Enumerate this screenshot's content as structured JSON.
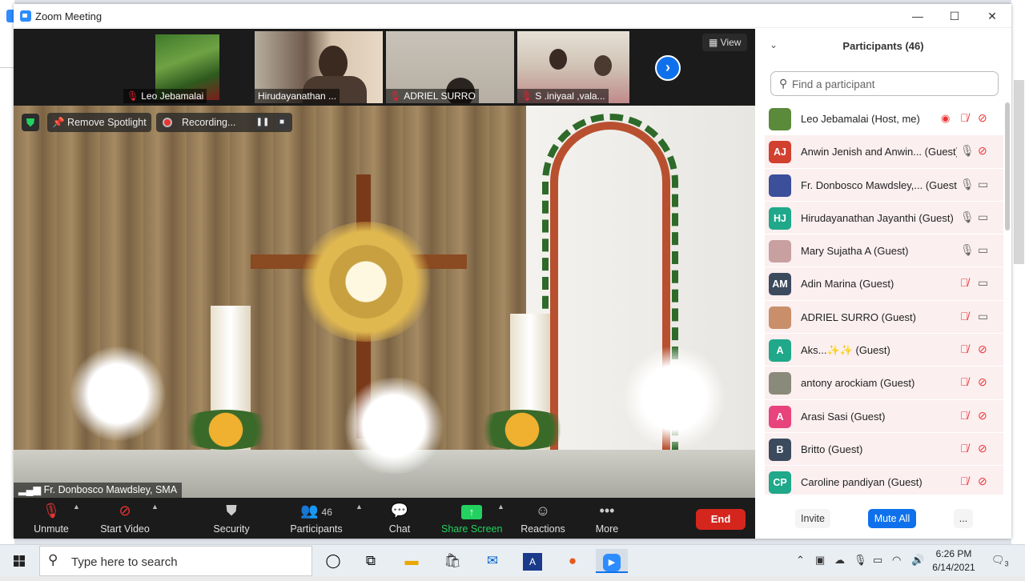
{
  "window": {
    "title": "Zoom Meeting",
    "minimize": "—",
    "maximize": "☐",
    "close": "✕"
  },
  "thumbnails": [
    {
      "name": "Leo Jebamalai"
    },
    {
      "name": "Hirudayanathan ..."
    },
    {
      "name": "ADRIEL SURRO"
    },
    {
      "name": "S .iniyaal ,vala..."
    }
  ],
  "strip": {
    "view_label": "View",
    "next": "›"
  },
  "spotlight": {
    "remove_label": "Remove Spotlight",
    "recording_label": "Recording...",
    "pause": "❚❚",
    "stop": "■"
  },
  "speaker": {
    "name": "Fr. Donbosco Mawdsley, SMA"
  },
  "toolbar": {
    "unmute": "Unmute",
    "start_video": "Start Video",
    "security": "Security",
    "participants": "Participants",
    "participants_count": "46",
    "chat": "Chat",
    "share_screen": "Share Screen",
    "reactions": "Reactions",
    "more": "More",
    "end": "End"
  },
  "panel": {
    "title": "Participants (46)",
    "search_placeholder": "Find a participant",
    "participants": [
      {
        "initials": "",
        "color": "#5a8a3a",
        "name": "Leo Jebamalai (Host, me)",
        "audio": "muted",
        "video": "off"
      },
      {
        "initials": "AJ",
        "color": "#d2402f",
        "name": "Anwin Jenish and Anwin... (Guest)",
        "audio": "on",
        "video": "off"
      },
      {
        "initials": "",
        "color": "#3b4f9a",
        "name": "Fr. Donbosco Mawdsley,... (Guest)",
        "audio": "on",
        "video": "on"
      },
      {
        "initials": "HJ",
        "color": "#1fa88a",
        "name": "Hirudayanathan Jayanthi (Guest)",
        "audio": "on",
        "video": "on"
      },
      {
        "initials": "",
        "color": "#c9a0a0",
        "name": "Mary Sujatha A (Guest)",
        "audio": "on",
        "video": "on"
      },
      {
        "initials": "AM",
        "color": "#3c4a5e",
        "name": "Adin Marina (Guest)",
        "audio": "muted",
        "video": "on"
      },
      {
        "initials": "",
        "color": "#c98f6a",
        "name": "ADRIEL SURRO (Guest)",
        "audio": "muted",
        "video": "on"
      },
      {
        "initials": "A",
        "color": "#1fa88a",
        "name": "Aks...✨✨ (Guest)",
        "audio": "muted",
        "video": "off"
      },
      {
        "initials": "",
        "color": "#8a8a7a",
        "name": "antony arockiam (Guest)",
        "audio": "muted",
        "video": "off"
      },
      {
        "initials": "A",
        "color": "#e8437c",
        "name": "Arasi Sasi (Guest)",
        "audio": "muted",
        "video": "off"
      },
      {
        "initials": "B",
        "color": "#3c4a5e",
        "name": "Britto (Guest)",
        "audio": "muted",
        "video": "off"
      },
      {
        "initials": "CP",
        "color": "#1fa88a",
        "name": "Caroline pandiyan (Guest)",
        "audio": "muted",
        "video": "off"
      }
    ],
    "invite": "Invite",
    "mute_all": "Mute All",
    "more": "..."
  },
  "taskbar": {
    "search_text": "Type here to search",
    "time": "6:26 PM",
    "date": "6/14/2021",
    "notifications": "3"
  }
}
